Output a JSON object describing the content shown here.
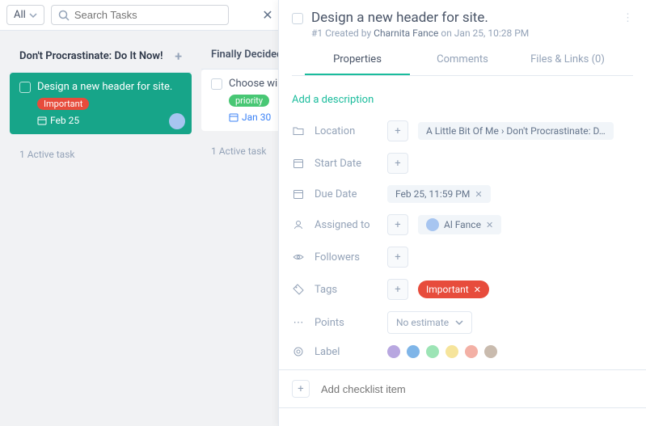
{
  "topbar": {
    "filter_label": "All",
    "search_placeholder": "Search Tasks"
  },
  "columns": [
    {
      "title": "Don't Procrastinate: Do It Now!",
      "cards": [
        {
          "title": "Design a new header for site.",
          "tag": "Important",
          "date": "Feb 25"
        }
      ],
      "footer": "1 Active task"
    },
    {
      "title": "Finally Decided t",
      "cards": [
        {
          "title": "Choose winne",
          "tag": "priority",
          "date": "Jan 30"
        }
      ],
      "footer": "1 Active task"
    }
  ],
  "panel": {
    "title": "Design a new header for site.",
    "meta_prefix": "#1 Created by ",
    "meta_author": "Charnita Fance",
    "meta_suffix": " on Jan 25, 10:28 PM",
    "tabs": {
      "properties": "Properties",
      "comments": "Comments",
      "files": "Files & Links (0)"
    },
    "description_cta": "Add a description",
    "props": {
      "location": {
        "label": "Location",
        "path": "A Little Bit Of Me › Don't Procrastinate: D…"
      },
      "start_date": {
        "label": "Start Date"
      },
      "due_date": {
        "label": "Due Date",
        "value": "Feb 25, 11:59 PM"
      },
      "assigned": {
        "label": "Assigned to",
        "name": "Al Fance"
      },
      "followers": {
        "label": "Followers"
      },
      "tags": {
        "label": "Tags",
        "value": "Important"
      },
      "points": {
        "label": "Points",
        "value": "No estimate"
      },
      "label": {
        "label": "Label"
      }
    },
    "checklist_placeholder": "Add checklist item",
    "label_colors": [
      "#b8a7e0",
      "#7fb5e8",
      "#9ce4b5",
      "#f6e49b",
      "#f3b0a5",
      "#c9bbae"
    ]
  }
}
